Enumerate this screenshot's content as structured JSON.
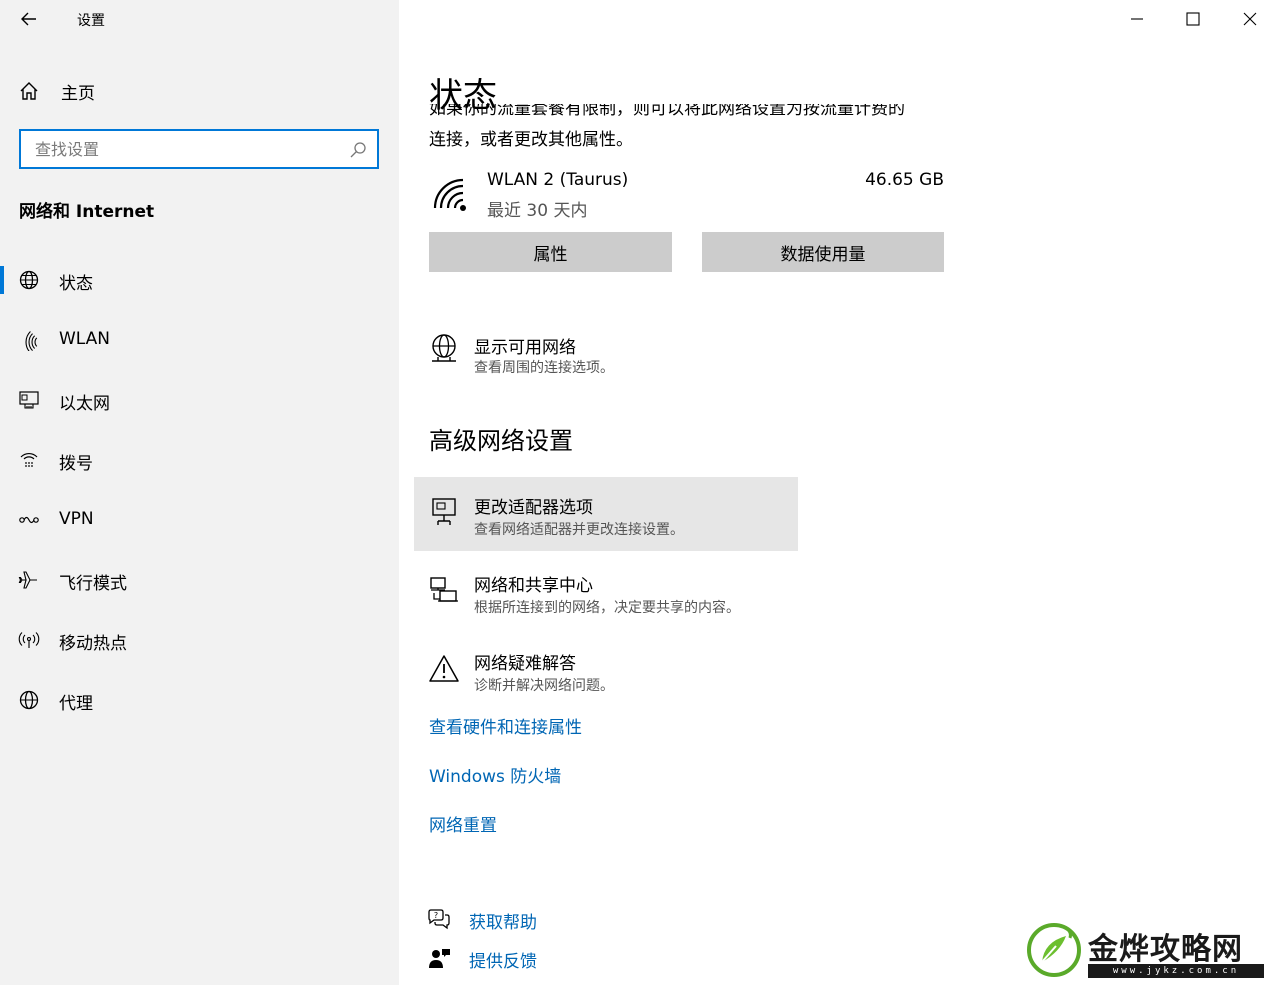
{
  "window": {
    "title": "设置"
  },
  "sidebar": {
    "home_label": "主页",
    "search_placeholder": "查找设置",
    "section_title": "网络和 Internet",
    "items": [
      {
        "label": "状态",
        "icon": "globe-icon",
        "active": true
      },
      {
        "label": "WLAN",
        "icon": "wifi-icon"
      },
      {
        "label": "以太网",
        "icon": "ethernet-icon"
      },
      {
        "label": "拨号",
        "icon": "dialup-icon"
      },
      {
        "label": "VPN",
        "icon": "vpn-icon"
      },
      {
        "label": "飞行模式",
        "icon": "airplane-icon"
      },
      {
        "label": "移动热点",
        "icon": "hotspot-icon"
      },
      {
        "label": "代理",
        "icon": "globe-icon"
      }
    ]
  },
  "main": {
    "page_title": "状态",
    "clipped_text": "如果你的流量套餐有限制，则可以将此网络设置为按流量计费的",
    "desc_line": "连接，或者更改其他属性。",
    "network": {
      "name": "WLAN 2 (Taurus)",
      "sub": "最近 30 天内",
      "usage": "46.65 GB"
    },
    "buttons": {
      "properties": "属性",
      "data_usage": "数据使用量"
    },
    "show_networks": {
      "title": "显示可用网络",
      "sub": "查看周围的连接选项。"
    },
    "advanced_title": "高级网络设置",
    "options": [
      {
        "title": "更改适配器选项",
        "sub": "查看网络适配器并更改连接设置。"
      },
      {
        "title": "网络和共享中心",
        "sub": "根据所连接到的网络，决定要共享的内容。"
      },
      {
        "title": "网络疑难解答",
        "sub": "诊断并解决网络问题。"
      }
    ],
    "links": [
      "查看硬件和连接属性",
      "Windows 防火墙",
      "网络重置"
    ],
    "help": {
      "get_help": "获取帮助",
      "feedback": "提供反馈"
    }
  },
  "watermark": {
    "text": "金烨攻略网",
    "url": "www.jykz.com.cn"
  },
  "colors": {
    "accent": "#0078d7",
    "link": "#0066b4",
    "sidebar_bg": "#f2f2f2",
    "button_bg": "#cccccc"
  }
}
